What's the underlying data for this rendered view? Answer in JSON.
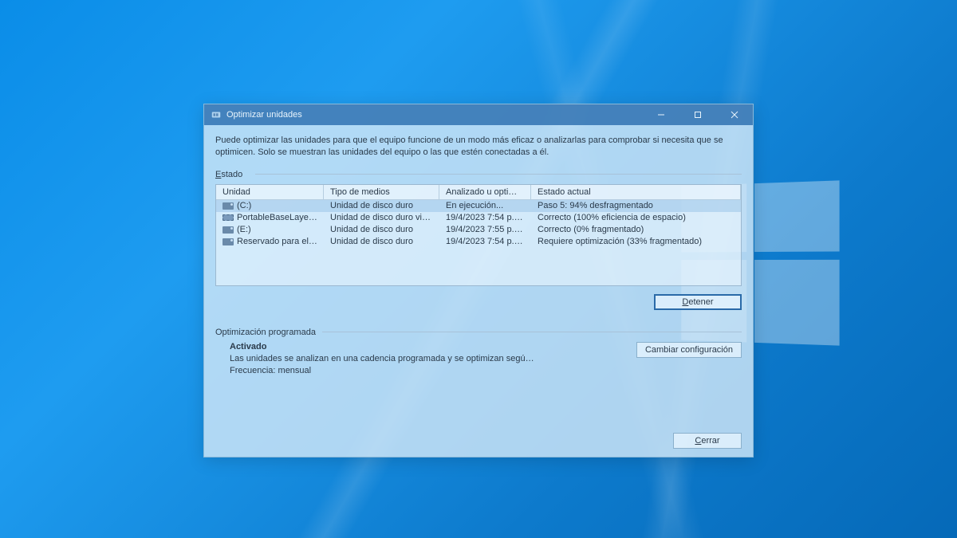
{
  "titlebar": {
    "title": "Optimizar unidades"
  },
  "description": "Puede optimizar las unidades para que el equipo funcione de un modo más eficaz o analizarlas para comprobar si necesita que se optimicen. Solo se muestran las unidades del equipo o las que estén conectadas a él.",
  "status_label": "Estado",
  "status_label_underline": "E",
  "columns": {
    "drive": "Unidad",
    "media": "Tipo de medios",
    "analyzed": "Analizado u optim…",
    "status": "Estado actual"
  },
  "drives": [
    {
      "icon": "hdd",
      "name": "(C:)",
      "media": "Unidad de disco duro",
      "analyzed": "En ejecución...",
      "status": "Paso 5: 94% desfragmentado",
      "selected": true
    },
    {
      "icon": "vhd",
      "name": "PortableBaseLayer …",
      "media": "Unidad de disco duro vi…",
      "analyzed": "19/4/2023 7:54 p. m.",
      "status": "Correcto (100% eficiencia de espacio)",
      "selected": false
    },
    {
      "icon": "hdd",
      "name": "(E:)",
      "media": "Unidad de disco duro",
      "analyzed": "19/4/2023 7:55 p. m.",
      "status": "Correcto (0% fragmentado)",
      "selected": false
    },
    {
      "icon": "hdd",
      "name": "Reservado para el s…",
      "media": "Unidad de disco duro",
      "analyzed": "19/4/2023 7:54 p. m.",
      "status": "Requiere optimización (33% fragmentado)",
      "selected": false
    }
  ],
  "buttons": {
    "stop": "Detener",
    "stop_underline": "D",
    "change_settings": "Cambiar configuración",
    "close": "Cerrar",
    "close_underline": "C"
  },
  "scheduled": {
    "label": "Optimización programada",
    "state": "Activado",
    "line1": "Las unidades se analizan en una cadencia programada y se optimizan segú…",
    "line2": "Frecuencia: mensual"
  }
}
